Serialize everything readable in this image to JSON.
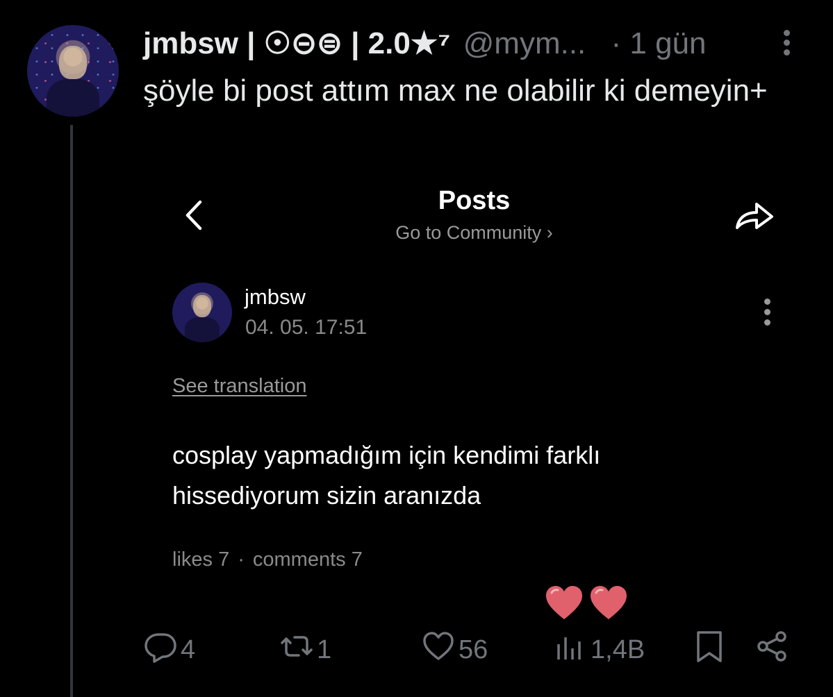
{
  "tweet": {
    "display_name": "jmbsw | ☉⊝⊜ | 2.0★⁷",
    "handle": "@mym...",
    "time": "· 1 gün",
    "text": "şöyle bi post attım max ne olabilir ki demeyin+"
  },
  "embedded": {
    "title": "Posts",
    "community_link": "Go to Community ›",
    "author": "jmbsw",
    "date": "04. 05. 17:51",
    "see_translation": "See translation",
    "body": "cosplay yapmadığım için kendimi farklı hissediyorum sizin aranızda",
    "likes": "likes 7",
    "comments": "comments 7",
    "separator": "·",
    "heart_color": "#e0606c"
  },
  "actions": {
    "replies": "4",
    "reposts": "1",
    "likes": "56",
    "views": "1,4B"
  },
  "colors": {
    "background": "#000000",
    "text": "#e7e9ea",
    "muted": "#71767b"
  }
}
